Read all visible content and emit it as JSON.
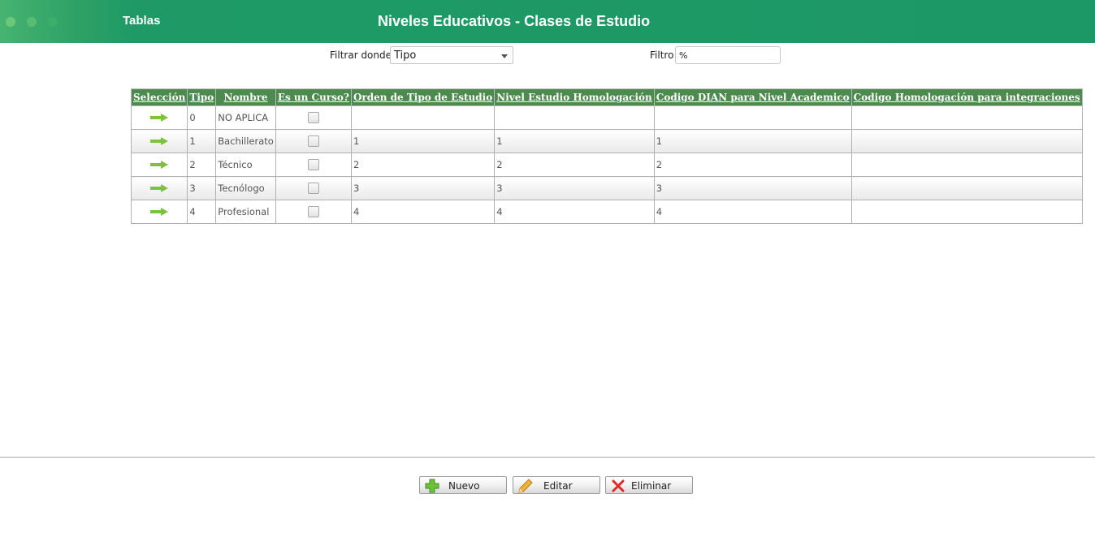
{
  "header": {
    "app_title": "Tablas",
    "page_title": "Niveles Educativos - Clases de Estudio"
  },
  "filter": {
    "where_label": "Filtrar donde",
    "where_value": "Tipo",
    "filter_label": "Filtro",
    "filter_value": "%"
  },
  "table": {
    "columns": [
      "Selección",
      "Tipo",
      "Nombre",
      "Es un Curso?",
      "Orden de Tipo de Estudio",
      "Nivel Estudio Homologación",
      "Codigo DIAN para Nivel Academico",
      "Codigo Homologación para integraciones"
    ],
    "rows": [
      {
        "tipo": "0",
        "nombre": "NO APLICA",
        "curso": false,
        "orden": "",
        "nivel": "",
        "dian": "",
        "homolog": ""
      },
      {
        "tipo": "1",
        "nombre": "Bachillerato",
        "curso": false,
        "orden": "1",
        "nivel": "1",
        "dian": "1",
        "homolog": ""
      },
      {
        "tipo": "2",
        "nombre": "Técnico",
        "curso": false,
        "orden": "2",
        "nivel": "2",
        "dian": "2",
        "homolog": ""
      },
      {
        "tipo": "3",
        "nombre": "Tecnólogo",
        "curso": false,
        "orden": "3",
        "nivel": "3",
        "dian": "3",
        "homolog": ""
      },
      {
        "tipo": "4",
        "nombre": "Profesional",
        "curso": false,
        "orden": "4",
        "nivel": "4",
        "dian": "4",
        "homolog": ""
      }
    ]
  },
  "buttons": {
    "new": "Nuevo",
    "edit": "Editar",
    "delete": "Eliminar"
  },
  "colors": {
    "header": "#1c9866",
    "table_header": "#4c8a4f",
    "arrow": "#7cc23f"
  },
  "icons": {
    "select": "arrow-right-icon",
    "new": "plus-icon",
    "edit": "pencil-icon",
    "delete": "x-icon"
  }
}
